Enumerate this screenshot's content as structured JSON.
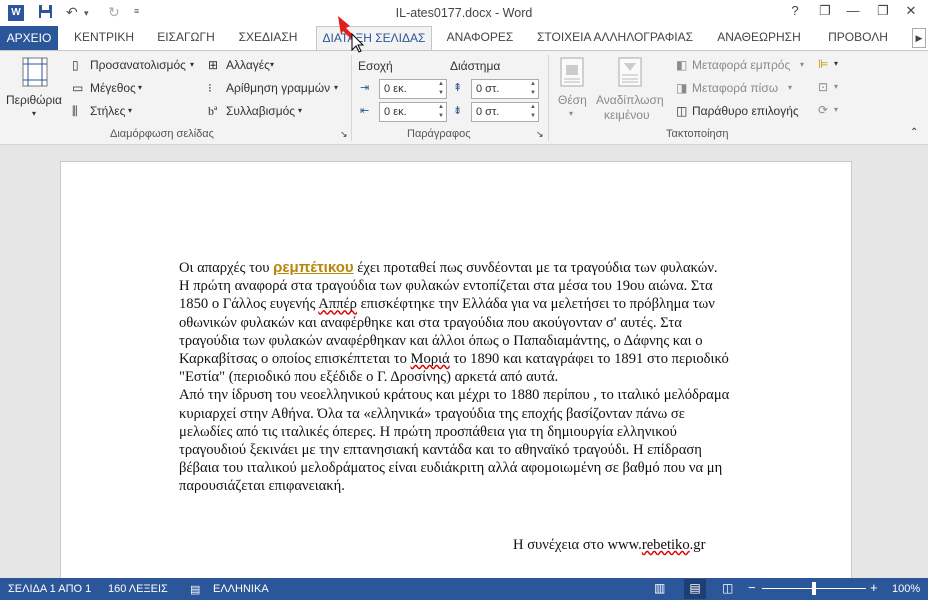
{
  "window": {
    "title": "IL-ates0177.docx - Word",
    "help": "?",
    "restore": "❐",
    "minimize": "—",
    "maximize": "❐",
    "close": "✕"
  },
  "tabs": {
    "file": "ΑΡΧΕΙΟ",
    "items": [
      "ΚΕΝΤΡΙΚΗ",
      "ΕΙΣΑΓΩΓΗ",
      "ΣΧΕΔΙΑΣΗ",
      "ΔΙΑΤΑΞΗ ΣΕΛΙΔΑΣ",
      "ΑΝΑΦΟΡΕΣ",
      "ΣΤΟΙΧΕΙΑ ΑΛΛΗΛΟΓΡΑΦΙΑΣ",
      "ΑΝΑΘΕΩΡΗΣΗ",
      "ΠΡΟΒΟΛΗ"
    ],
    "active": "ΔΙΑΤΑΞΗ ΣΕΛΙΔΑΣ"
  },
  "ribbon": {
    "page_setup": {
      "margins": "Περιθώρια",
      "orientation": "Προσανατολισμός",
      "size": "Μέγεθος",
      "columns": "Στήλες",
      "breaks": "Αλλαγές",
      "line_numbers": "Αρίθμηση γραμμών",
      "hyphenation": "Συλλαβισμός",
      "group": "Διαμόρφωση σελίδας"
    },
    "paragraph": {
      "indent": "Εσοχή",
      "spacing": "Διάστημα",
      "indent_left": "0 εκ.",
      "indent_right": "0 εκ.",
      "space_before": "0 στ.",
      "space_after": "0 στ.",
      "group": "Παράγραφος"
    },
    "arrange": {
      "position": "Θέση",
      "wrap": "Αναδίπλωση",
      "wrap2": "κειμένου",
      "forward": "Μεταφορά εμπρός",
      "backward": "Μεταφορά πίσω",
      "pane": "Παράθυρο επιλογής",
      "group": "Τακτοποίηση"
    }
  },
  "document": {
    "p1_before": "Οι απαρχές του ",
    "p1_link": "ρεμπέτικου",
    "p1_after": " έχει προταθεί πως συνδέονται με τα τραγούδια των φυλακών. Η πρώτη αναφορά στα τραγούδια των φυλακών εντοπίζεται στα μέσα του 19ου αιώνα. Στα 1850 ο Γάλλος ευγενής ",
    "p1_w1": "Αππέρ",
    "p1_after2": " επισκέφτηκε την Ελλάδα για να μελετήσει το πρόβλημα των οθωνικών φυλακών και αναφέρθηκε και στα τραγούδια που ακούγονταν σ' αυτές. Στα τραγούδια των φυλακών αναφέρθηκαν και άλλοι όπως ο Παπαδιαμάντης, ο Δάφνης και ο Καρκαβίτσας ο οποίος επισκέπτεται  το ",
    "p1_w2": "Μοριά",
    "p1_after3": " το 1890 και καταγράφει το 1891 στο περιοδικό  \"Εστία\" (περιοδικό που εξέδιδε ο Γ. Δροσίνης) αρκετά από αυτά.",
    "p2": "Από την ίδρυση του νεοελληνικού κράτους και μέχρι το 1880 περίπου , το ιταλικό μελόδραμα κυριαρχεί στην Αθήνα.  Όλα τα «ελληνικά» τραγούδια της εποχής βασίζονταν πάνω σε μελωδίες από τις ιταλικές όπερες. Η πρώτη προσπάθεια για τη δημιουργία ελληνικού τραγουδιού ξεκινάει με την επτανησιακή καντάδα και το αθηναϊκό τραγούδι. Η επίδραση βέβαια του ιταλικού μελοδράματος είναι ευδιάκριτη αλλά αφομοιωμένη σε βαθμό που να μη παρουσιάζεται επιφανειακή.",
    "sig_before": "Η συνέχεια στο   www.",
    "sig_word": "rebetiko",
    "sig_after": ".gr"
  },
  "status": {
    "page": "ΣΕΛΙΔΑ 1 ΑΠΟ 1",
    "words": "160 ΛΕΞΕΙΣ",
    "language": "ΕΛΛΗΝΙΚΑ",
    "zoom": "100%"
  },
  "colors": {
    "accent": "#2b579a",
    "link": "#b8860b"
  }
}
